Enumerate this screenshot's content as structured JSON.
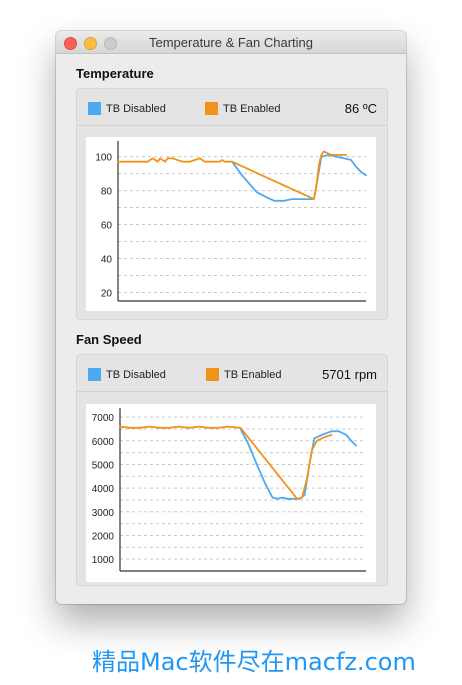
{
  "window": {
    "title": "Temperature & Fan Charting"
  },
  "colors": {
    "disabled": "#4daaf0",
    "enabled": "#f39219"
  },
  "temperature": {
    "heading": "Temperature",
    "legend_disabled": "TB Disabled",
    "legend_enabled": "TB Enabled",
    "readout": "86 ºC"
  },
  "fan": {
    "heading": "Fan Speed",
    "legend_disabled": "TB Disabled",
    "legend_enabled": "TB Enabled",
    "readout": "5701 rpm"
  },
  "watermark": "精品Mac软件尽在macfz.com",
  "chart_data": [
    {
      "type": "line",
      "yticks": [
        "20",
        "40",
        "60",
        "80",
        "100"
      ],
      "ylim": [
        15,
        108
      ],
      "xlim": [
        0,
        100
      ],
      "grid": "dashed-horizontal",
      "series": [
        {
          "name": "TB Disabled",
          "points": [
            [
              46,
              97
            ],
            [
              50,
              89
            ],
            [
              53,
              84
            ],
            [
              56,
              79
            ],
            [
              60,
              76
            ],
            [
              63,
              74
            ],
            [
              67,
              74
            ],
            [
              70,
              75
            ],
            [
              74,
              75
            ],
            [
              78,
              75
            ],
            [
              79,
              75
            ],
            [
              80,
              83
            ],
            [
              82,
              100
            ],
            [
              85,
              101
            ],
            [
              88,
              100
            ],
            [
              91,
              99
            ],
            [
              94,
              98
            ],
            [
              96,
              94
            ],
            [
              98,
              91
            ],
            [
              100,
              89
            ]
          ]
        },
        {
          "name": "TB Enabled",
          "points": [
            [
              0,
              97
            ],
            [
              12,
              97
            ],
            [
              13,
              98
            ],
            [
              14,
              99
            ],
            [
              15,
              98
            ],
            [
              16,
              97
            ],
            [
              17,
              99
            ],
            [
              18,
              98
            ],
            [
              19,
              97
            ],
            [
              20,
              99
            ],
            [
              22,
              99
            ],
            [
              24,
              98
            ],
            [
              26,
              97
            ],
            [
              29,
              97
            ],
            [
              31,
              98
            ],
            [
              33,
              99
            ],
            [
              35,
              97
            ],
            [
              38,
              97
            ],
            [
              41,
              97
            ],
            [
              42,
              98
            ],
            [
              43,
              97
            ],
            [
              46,
              97
            ],
            [
              79,
              75
            ],
            [
              80,
              83
            ],
            [
              81,
              95
            ],
            [
              82,
              101
            ],
            [
              83,
              103
            ],
            [
              86,
              101
            ],
            [
              89,
              101
            ],
            [
              92,
              101
            ]
          ]
        }
      ]
    },
    {
      "type": "line",
      "yticks": [
        "1000",
        "2000",
        "3000",
        "4000",
        "5000",
        "6000",
        "7000"
      ],
      "ylim": [
        500,
        7300
      ],
      "xlim": [
        0,
        100
      ],
      "grid": "dashed-horizontal",
      "series": [
        {
          "name": "TB Disabled",
          "points": [
            [
              49,
              6500
            ],
            [
              52,
              5900
            ],
            [
              56,
              4900
            ],
            [
              59,
              4200
            ],
            [
              62,
              3600
            ],
            [
              64,
              3550
            ],
            [
              66,
              3600
            ],
            [
              68,
              3550
            ],
            [
              70,
              3550
            ],
            [
              73,
              3550
            ],
            [
              75,
              3700
            ],
            [
              77,
              5000
            ],
            [
              79,
              6100
            ],
            [
              82,
              6250
            ],
            [
              86,
              6400
            ],
            [
              89,
              6400
            ],
            [
              92,
              6250
            ],
            [
              94,
              6000
            ],
            [
              96,
              5800
            ]
          ]
        },
        {
          "name": "TB Enabled",
          "points": [
            [
              0,
              6600
            ],
            [
              4,
              6550
            ],
            [
              8,
              6550
            ],
            [
              12,
              6600
            ],
            [
              16,
              6550
            ],
            [
              20,
              6550
            ],
            [
              24,
              6600
            ],
            [
              28,
              6550
            ],
            [
              32,
              6600
            ],
            [
              36,
              6550
            ],
            [
              40,
              6550
            ],
            [
              44,
              6600
            ],
            [
              49,
              6550
            ],
            [
              72,
              3550
            ],
            [
              74,
              3600
            ],
            [
              76,
              4400
            ],
            [
              78,
              5600
            ],
            [
              80,
              6000
            ],
            [
              83,
              6150
            ],
            [
              86,
              6250
            ]
          ]
        }
      ]
    }
  ]
}
